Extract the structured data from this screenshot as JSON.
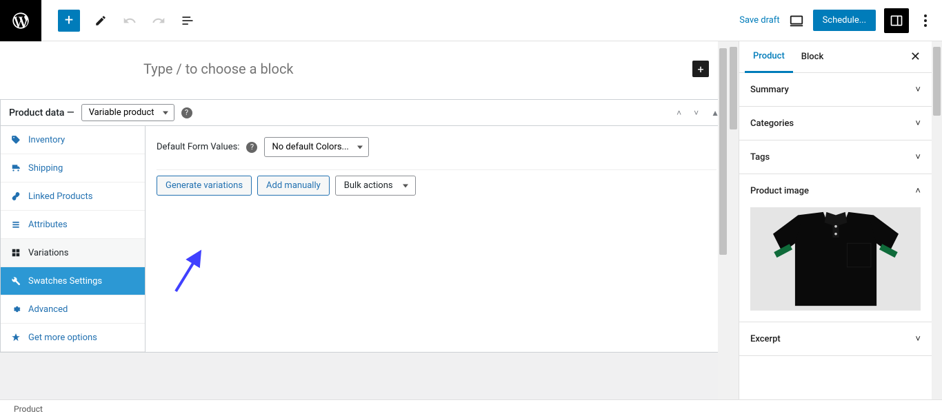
{
  "topbar": {
    "save_draft": "Save draft",
    "schedule": "Schedule..."
  },
  "editor": {
    "placeholder": "Type / to choose a block"
  },
  "product_data": {
    "label": "Product data —",
    "type_select": "Variable product",
    "tabs": {
      "inventory": "Inventory",
      "shipping": "Shipping",
      "linked": "Linked Products",
      "attributes": "Attributes",
      "variations": "Variations",
      "swatches": "Swatches Settings",
      "advanced": "Advanced",
      "more": "Get more options"
    },
    "default_form_label": "Default Form Values:",
    "default_form_select": "No default Colors...",
    "generate_btn": "Generate variations",
    "add_manually_btn": "Add manually",
    "bulk_actions": "Bulk actions"
  },
  "right_sidebar": {
    "tab_product": "Product",
    "tab_block": "Block",
    "panels": {
      "summary": "Summary",
      "categories": "Categories",
      "tags": "Tags",
      "product_image": "Product image",
      "excerpt": "Excerpt"
    }
  },
  "footer": {
    "breadcrumb": "Product"
  }
}
